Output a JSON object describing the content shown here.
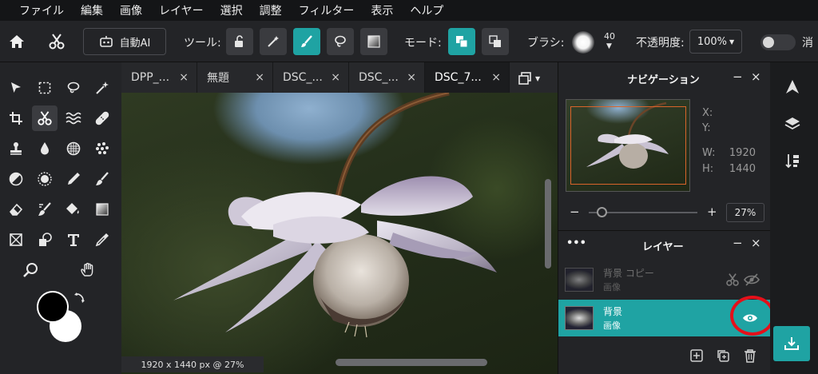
{
  "menu": [
    "ファイル",
    "編集",
    "画像",
    "レイヤー",
    "選択",
    "調整",
    "フィルター",
    "表示",
    "ヘルプ"
  ],
  "toolbar": {
    "auto_ai_label": "自動AI",
    "tool_label": "ツール:",
    "mode_label": "モード:",
    "brush_label": "ブラシ:",
    "brush_size": "40",
    "opacity_label": "不透明度:",
    "opacity_value": "100%",
    "erase_label": "消"
  },
  "tabs": [
    {
      "label": "DPP_...",
      "close": "×"
    },
    {
      "label": "無題",
      "close": "×"
    },
    {
      "label": "DSC_...",
      "close": "×"
    },
    {
      "label": "DSC_...",
      "close": "×"
    },
    {
      "label": "DSC_7...",
      "close": "×"
    }
  ],
  "canvas": {
    "status": "1920 x 1440 px @ 27%"
  },
  "navigation": {
    "title": "ナビゲーション",
    "minimize": "−",
    "close": "×",
    "x_label": "X:",
    "y_label": "Y:",
    "w_label": "W:",
    "h_label": "H:",
    "w_value": "1920",
    "h_value": "1440",
    "zoom_minus": "−",
    "zoom_plus": "+",
    "zoom_value": "27%",
    "zoom_level": 0.08
  },
  "layers": {
    "title": "レイヤー",
    "more": "•••",
    "minimize": "−",
    "close": "×",
    "items": [
      {
        "name": "背景 コピー",
        "type": "画像",
        "visible": false,
        "selected": false
      },
      {
        "name": "背景",
        "type": "画像",
        "visible": true,
        "selected": true
      }
    ]
  },
  "colors": {
    "accent": "#1fa3a3",
    "annotation_circle": "#e5101a",
    "foreground": "#000000",
    "background": "#ffffff"
  }
}
